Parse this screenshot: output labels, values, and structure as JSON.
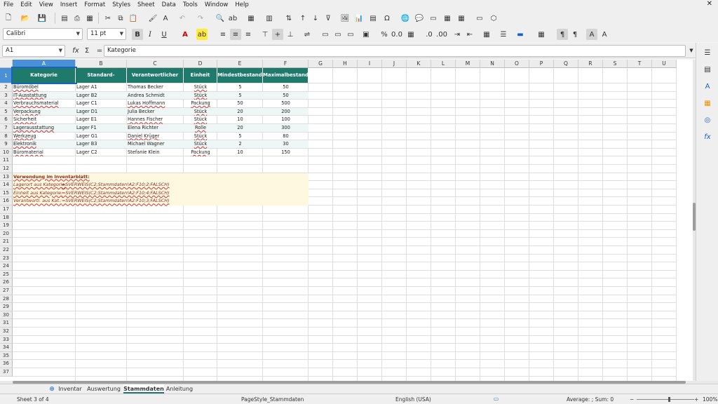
{
  "menu": [
    "File",
    "Edit",
    "View",
    "Insert",
    "Format",
    "Styles",
    "Sheet",
    "Data",
    "Tools",
    "Window",
    "Help"
  ],
  "font": {
    "name": "Calibri",
    "size": "11 pt"
  },
  "formula_bar": {
    "cell_ref": "A1",
    "content": "Kategorie"
  },
  "columns": [
    "A",
    "B",
    "C",
    "D",
    "E",
    "F",
    "G",
    "H",
    "I",
    "J",
    "K",
    "L",
    "M",
    "N",
    "O",
    "P",
    "Q",
    "R",
    "S",
    "T",
    "U"
  ],
  "header_row": [
    "Kategorie",
    "Standard-Lagerort",
    "Verantwortlicher",
    "Einheit",
    "Mindestbestand",
    "Maximalbestand"
  ],
  "rows": [
    [
      "Büromöbel",
      "Lager A1",
      "Thomas Becker",
      "Stück",
      "5",
      "50"
    ],
    [
      "IT-Ausstattung",
      "Lager B2",
      "Andrea Schmidt",
      "Stück",
      "5",
      "50"
    ],
    [
      "Verbrauchsmaterial",
      "Lager C1",
      "Lukas Hoffmann",
      "Packung",
      "50",
      "500"
    ],
    [
      "Verpackung",
      "Lager D1",
      "Julia Becker",
      "Stück",
      "20",
      "200"
    ],
    [
      "Sicherheit",
      "Lager E1",
      "Hannes Fischer",
      "Stück",
      "10",
      "100"
    ],
    [
      "Lagerausstattung",
      "Lager F1",
      "Elena Richter",
      "Rolle",
      "20",
      "300"
    ],
    [
      "Werkzeug",
      "Lager G1",
      "Daniel Krüger",
      "Stück",
      "5",
      "80"
    ],
    [
      "Elektronik",
      "Lager B3",
      "Michael Wagner",
      "Stück",
      "2",
      "30"
    ],
    [
      "Büromaterial",
      "Lager C2",
      "Stefanie Klein",
      "Packung",
      "10",
      "150"
    ]
  ],
  "notes": {
    "title": "Verwendung im Inventarblatt:",
    "lines": [
      {
        "label": "Lagerort aus Kategorie:",
        "formula": "=SVERWEIS(C2;Stammdaten!A2:F10;2;FALSCH)"
      },
      {
        "label": "Einheit aus Kategorie:",
        "formula": "=SVERWEIS(C2;Stammdaten!A2:F10;4;FALSCH)"
      },
      {
        "label": "Verantwortl. aus Kat.:",
        "formula": "=SVERWEIS(C2;Stammdaten!A2:F10;3;FALSCH)"
      }
    ]
  },
  "row_numbers": [
    "1",
    "2",
    "3",
    "4",
    "5",
    "6",
    "7",
    "8",
    "9",
    "10",
    "11",
    "12",
    "13",
    "14",
    "15",
    "16",
    "17",
    "18",
    "19",
    "20",
    "21",
    "22",
    "23",
    "24",
    "25",
    "26",
    "27",
    "28",
    "29",
    "30",
    "31",
    "32",
    "33",
    "34",
    "35",
    "36",
    "37"
  ],
  "tabs": [
    "Inventar",
    "Auswertung",
    "Stammdaten",
    "Anleitung"
  ],
  "active_tab": "Stammdaten",
  "status": {
    "sheet": "Sheet 3 of 4",
    "page_style": "PageStyle_Stammdaten",
    "language": "English (USA)",
    "summary": "Average: ; Sum: 0",
    "zoom": "100%"
  },
  "colors": {
    "header_bg": "#1f7a6b",
    "selected": "#4a90d9",
    "note_bg": "#fff8e1"
  }
}
